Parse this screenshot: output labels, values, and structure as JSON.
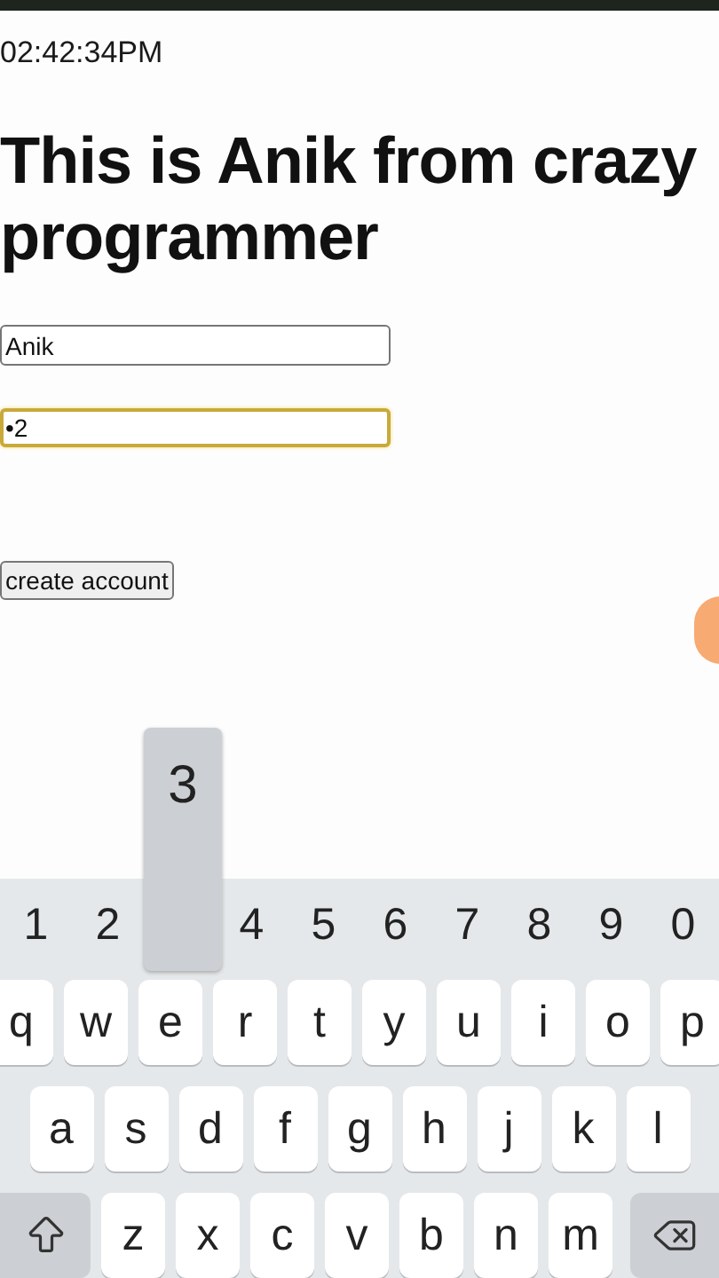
{
  "time": "02:42:34PM",
  "heading": "This is Anik from crazy programmer",
  "fields": [
    {
      "value": "Anik",
      "focused": false
    },
    {
      "value": "•2",
      "focused": true
    }
  ],
  "button": "create account",
  "keyboard": {
    "number_row": [
      {
        "label": "1",
        "pressed": false
      },
      {
        "label": "2",
        "pressed": false
      },
      {
        "label": "3",
        "pressed": true
      },
      {
        "label": "4",
        "pressed": false
      },
      {
        "label": "5",
        "pressed": false
      },
      {
        "label": "6",
        "pressed": false
      },
      {
        "label": "7",
        "pressed": false
      },
      {
        "label": "8",
        "pressed": false
      },
      {
        "label": "9",
        "pressed": false
      },
      {
        "label": "0",
        "pressed": false
      }
    ],
    "rows": [
      [
        "q",
        "w",
        "e",
        "r",
        "t",
        "y",
        "u",
        "i",
        "o",
        "p"
      ],
      [
        "a",
        "s",
        "d",
        "f",
        "g",
        "h",
        "j",
        "k",
        "l"
      ],
      [
        "z",
        "x",
        "c",
        "v",
        "b",
        "n",
        "m"
      ]
    ]
  }
}
